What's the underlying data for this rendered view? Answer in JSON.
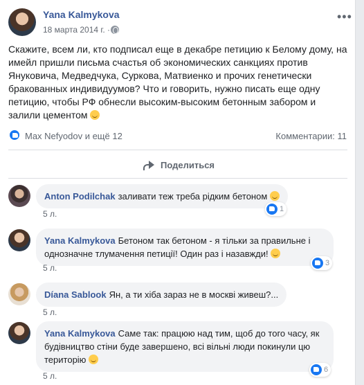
{
  "post": {
    "author": "Yana Kalmykova",
    "date": "18 марта 2014 г. ·",
    "privacy_icon": "globe-icon",
    "more_label": "•••",
    "text_main": "Скажите, всем ли, кто подписал еще в декабре петицию к Белому дому, на имейл пришли письма счастья об экономических санкциях против Януковича, Медведчука, Суркова, Матвиенко и прочих генетически бракованных индивидуумов? Что и говорить, нужно писать еще одну петицию, чтобы РФ обнесли высоким-высоким бетонным забором и залили цементом",
    "reactors": "Max Nefyodov и ещё 12",
    "comments_count": "Комментарии: 11",
    "share_label": "Поделиться"
  },
  "comments": [
    {
      "author": "Anton Podilchak",
      "text": "заливати теж треба рідким бетоном",
      "likes": "1",
      "time": "5 л."
    },
    {
      "author": "Yana Kalmykova",
      "text_line1": "Бетоном так бетоном - я тільки за правильне і",
      "text_line2": "однозначне тлумачення петиції! Один раз і назавжди!",
      "likes": "3",
      "time": "5 л."
    },
    {
      "author": "Díana Sablook",
      "text": "Ян, а ти хіба зараз не в москві живеш?...",
      "time": "5 л."
    },
    {
      "author": "Yana Kalmykova",
      "text_line1": "Саме так: працюю над тим, щоб до того часу, як",
      "text_line2": "будівництво стіни буде завершено, всі вільні люди покинули цю",
      "text_line3": "територію",
      "likes": "6",
      "time": "5 л."
    }
  ],
  "colors": {
    "link": "#385898",
    "like": "#1877f2",
    "bubble": "#f2f3f5",
    "muted": "#606770"
  }
}
